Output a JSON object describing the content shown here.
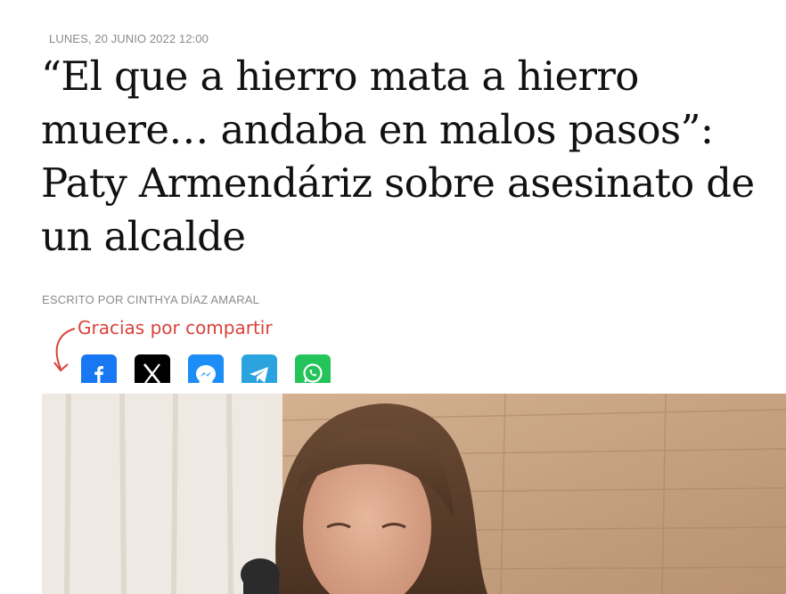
{
  "article": {
    "date": "LUNES, 20 JUNIO 2022 12:00",
    "headline": "“El que a hierro mata a hierro muere… andaba en malos pasos”: Paty Armendáriz sobre asesinato de un alcalde",
    "author": "ESCRITO POR CINTHYA DÍAZ AMARAL"
  },
  "share": {
    "label": "Gracias por compartir",
    "accent_color": "#d9423a",
    "buttons": [
      {
        "network": "Facebook",
        "icon": "facebook-icon",
        "color": "#1877f2"
      },
      {
        "network": "X",
        "icon": "x-icon",
        "color": "#000000"
      },
      {
        "network": "Messenger",
        "icon": "messenger-icon",
        "color": "#1d8ef5"
      },
      {
        "network": "Telegram",
        "icon": "telegram-icon",
        "color": "#2aa3df"
      },
      {
        "network": "WhatsApp",
        "icon": "whatsapp-icon",
        "color": "#25c45a"
      }
    ]
  },
  "hero_image": {
    "subject": "woman-speaking-at-microphone-photo"
  }
}
